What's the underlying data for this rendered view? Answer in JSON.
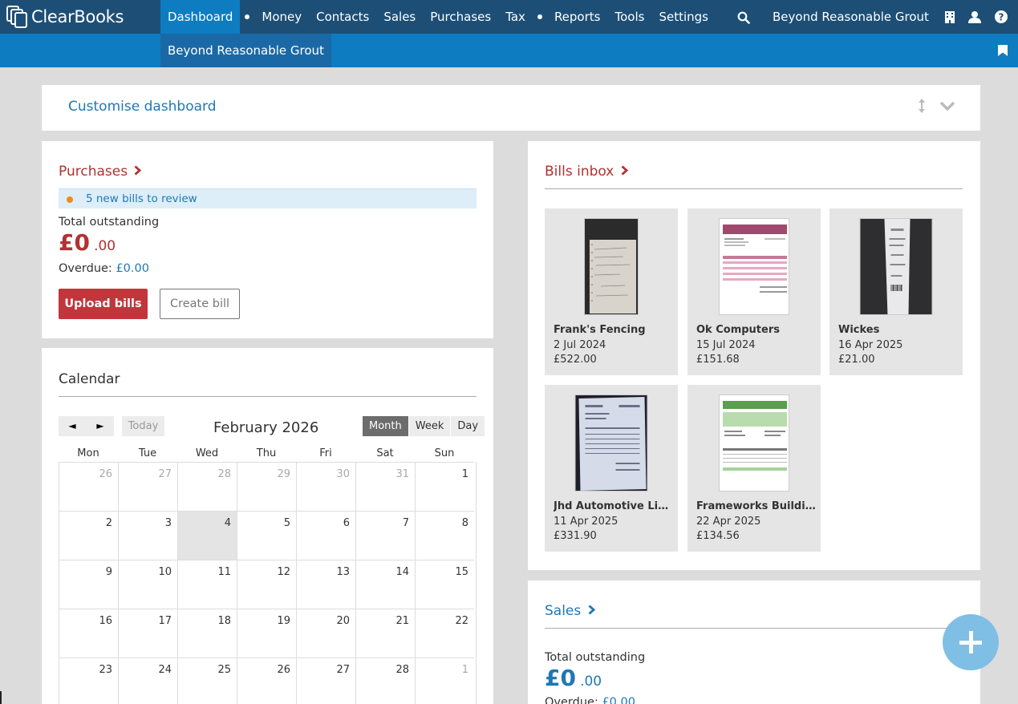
{
  "brand": {
    "name": "ClearBooks"
  },
  "nav": {
    "items": [
      {
        "label": "Dashboard",
        "active": true
      },
      {
        "label": "Money"
      },
      {
        "label": "Contacts"
      },
      {
        "label": "Sales"
      },
      {
        "label": "Purchases"
      },
      {
        "label": "Tax"
      },
      {
        "label": "Reports"
      },
      {
        "label": "Tools"
      },
      {
        "label": "Settings"
      }
    ],
    "org_name": "Beyond Reasonable Grout",
    "icons": [
      "search-icon",
      "building-icon",
      "user-icon",
      "help-icon"
    ]
  },
  "subnav": {
    "item": "Beyond Reasonable Grout",
    "icon": "bookmark-icon"
  },
  "customise": {
    "title": "Customise dashboard",
    "icons": [
      "resize-icon",
      "chevron-down-icon"
    ]
  },
  "purchases": {
    "title": "Purchases",
    "notice": "5 new bills to review",
    "total_label": "Total outstanding",
    "amount_main": "£0",
    "amount_dec": ".00",
    "overdue_label": "Overdue:",
    "overdue_value": "£0.00",
    "upload_label": "Upload bills",
    "create_label": "Create bill"
  },
  "calendar": {
    "title": "Calendar",
    "prev": "◄",
    "next": "►",
    "today_label": "Today",
    "month": "February 2026",
    "views": [
      "Month",
      "Week",
      "Day"
    ],
    "active_view": "Month",
    "weekdays": [
      "Mon",
      "Tue",
      "Wed",
      "Thu",
      "Fri",
      "Sat",
      "Sun"
    ],
    "weeks": [
      [
        {
          "d": "26",
          "o": true
        },
        {
          "d": "27",
          "o": true
        },
        {
          "d": "28",
          "o": true
        },
        {
          "d": "29",
          "o": true
        },
        {
          "d": "30",
          "o": true
        },
        {
          "d": "31",
          "o": true
        },
        {
          "d": "1"
        }
      ],
      [
        {
          "d": "2"
        },
        {
          "d": "3"
        },
        {
          "d": "4",
          "today": true
        },
        {
          "d": "5"
        },
        {
          "d": "6"
        },
        {
          "d": "7"
        },
        {
          "d": "8"
        }
      ],
      [
        {
          "d": "9"
        },
        {
          "d": "10"
        },
        {
          "d": "11"
        },
        {
          "d": "12"
        },
        {
          "d": "13"
        },
        {
          "d": "14"
        },
        {
          "d": "15"
        }
      ],
      [
        {
          "d": "16"
        },
        {
          "d": "17"
        },
        {
          "d": "18"
        },
        {
          "d": "19"
        },
        {
          "d": "20"
        },
        {
          "d": "21"
        },
        {
          "d": "22"
        }
      ],
      [
        {
          "d": "23"
        },
        {
          "d": "24"
        },
        {
          "d": "25"
        },
        {
          "d": "26"
        },
        {
          "d": "27"
        },
        {
          "d": "28"
        },
        {
          "d": "1",
          "o": true
        }
      ]
    ]
  },
  "bills_inbox": {
    "title": "Bills inbox",
    "items": [
      {
        "name": "Frank's Fencing",
        "date": "2 Jul 2024",
        "amount": "£522.00",
        "thumb": "handwritten-note"
      },
      {
        "name": "Ok Computers",
        "date": "15 Jul 2024",
        "amount": "£151.68",
        "thumb": "printed-invoice-purple"
      },
      {
        "name": "Wickes",
        "date": "16 Apr 2025",
        "amount": "£21.00",
        "thumb": "till-receipt"
      },
      {
        "name": "Jhd Automotive Limit...",
        "date": "11 Apr 2025",
        "amount": "£331.90",
        "thumb": "printed-invoice-photo"
      },
      {
        "name": "Frameworks Building",
        "date": "22 Apr 2025",
        "amount": "£134.56",
        "thumb": "printed-invoice-green"
      }
    ]
  },
  "sales": {
    "title": "Sales",
    "total_label": "Total outstanding",
    "amount_main": "£0",
    "amount_dec": ".00",
    "overdue_label": "Overdue:",
    "overdue_value": "£0.00"
  },
  "fab": {
    "icon": "plus-icon"
  },
  "colors": {
    "nav": "#1d4f76",
    "subnav": "#0d7cc1",
    "accent_red": "#b13232",
    "accent_blue": "#1f78b4"
  }
}
